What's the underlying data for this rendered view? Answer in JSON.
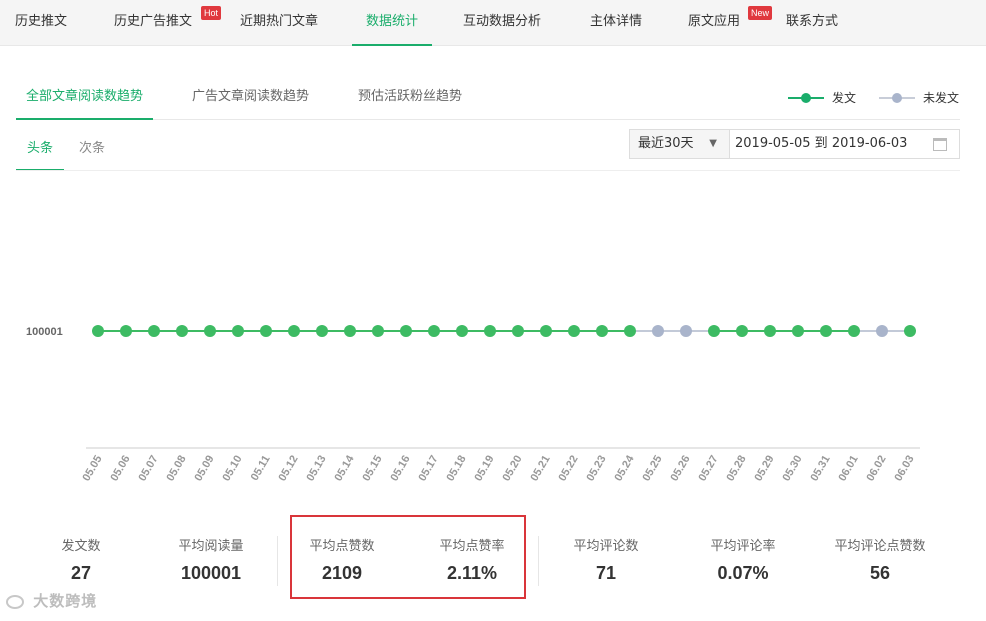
{
  "nav": {
    "tabs": [
      {
        "label": "历史推文"
      },
      {
        "label": "历史广告推文",
        "badge": "Hot"
      },
      {
        "label": "近期热门文章"
      },
      {
        "label": "数据统计",
        "active": true
      },
      {
        "label": "互动数据分析"
      },
      {
        "label": "主体详情"
      },
      {
        "label": "原文应用",
        "badge": "New"
      },
      {
        "label": "联系方式"
      }
    ]
  },
  "subtabs": [
    {
      "label": "全部文章阅读数趋势",
      "active": true
    },
    {
      "label": "广告文章阅读数趋势"
    },
    {
      "label": "预估活跃粉丝趋势"
    }
  ],
  "legend": {
    "published": "发文",
    "unpublished": "未发文"
  },
  "position_tabs": [
    {
      "label": "头条",
      "active": true
    },
    {
      "label": "次条"
    }
  ],
  "date_range": {
    "preset": "最近30天",
    "value": "2019-05-05 到 2019-06-03"
  },
  "colors": {
    "accent": "#1aad6b",
    "published_dot": "#3dbb63",
    "unpublished_dot": "#a9b4cb",
    "highlight_border": "#d9353a"
  },
  "chart_data": {
    "type": "line",
    "ytick_label": "100001",
    "x": [
      "05.05",
      "05.06",
      "05.07",
      "05.08",
      "05.09",
      "05.10",
      "05.11",
      "05.12",
      "05.13",
      "05.14",
      "05.15",
      "05.16",
      "05.17",
      "05.18",
      "05.19",
      "05.20",
      "05.21",
      "05.22",
      "05.23",
      "05.24",
      "05.25",
      "05.26",
      "05.27",
      "05.28",
      "05.29",
      "05.30",
      "05.31",
      "06.01",
      "06.02",
      "06.03"
    ],
    "values": [
      100001,
      100001,
      100001,
      100001,
      100001,
      100001,
      100001,
      100001,
      100001,
      100001,
      100001,
      100001,
      100001,
      100001,
      100001,
      100001,
      100001,
      100001,
      100001,
      100001,
      100001,
      100001,
      100001,
      100001,
      100001,
      100001,
      100001,
      100001,
      100001,
      100001
    ],
    "published": [
      true,
      true,
      true,
      true,
      true,
      true,
      true,
      true,
      true,
      true,
      true,
      true,
      true,
      true,
      true,
      true,
      true,
      true,
      true,
      true,
      false,
      false,
      true,
      true,
      true,
      true,
      true,
      true,
      false,
      true
    ],
    "legend": "top-right",
    "grid": false
  },
  "stats": [
    {
      "label": "发文数",
      "value": "27"
    },
    {
      "label": "平均阅读量",
      "value": "100001"
    },
    {
      "label": "平均点赞数",
      "value": "2109"
    },
    {
      "label": "平均点赞率",
      "value": "2.11%"
    },
    {
      "label": "平均评论数",
      "value": "71"
    },
    {
      "label": "平均评论率",
      "value": "0.07%"
    },
    {
      "label": "平均评论点赞数",
      "value": "56"
    }
  ],
  "watermark": "大数跨境"
}
